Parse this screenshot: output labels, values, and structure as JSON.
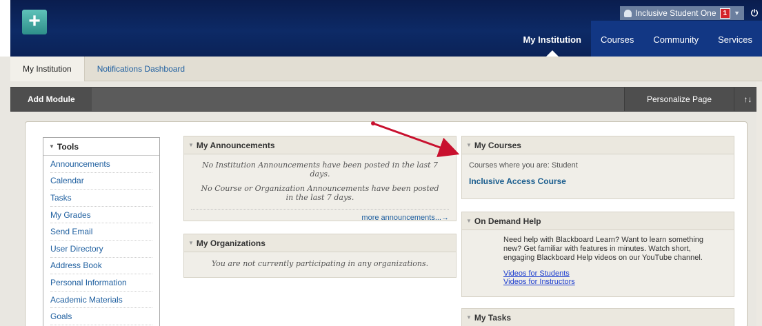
{
  "header": {
    "user_name": "Inclusive Student One",
    "notification_count": "1",
    "nav_tabs": [
      "My Institution",
      "Courses",
      "Community",
      "Services"
    ]
  },
  "subtabs": [
    "My Institution",
    "Notifications Dashboard"
  ],
  "toolbar": {
    "add_module": "Add Module",
    "personalize": "Personalize Page",
    "reorder": "↑↓"
  },
  "tools": {
    "title": "Tools",
    "items": [
      "Announcements",
      "Calendar",
      "Tasks",
      "My Grades",
      "Send Email",
      "User Directory",
      "Address Book",
      "Personal Information",
      "Academic Materials",
      "Goals"
    ]
  },
  "announcements": {
    "title": "My Announcements",
    "msg1": "No Institution Announcements have been posted in the last 7 days.",
    "msg2": "No Course or Organization Announcements have been posted in the last 7 days.",
    "more": "more announcements...→"
  },
  "organizations": {
    "title": "My Organizations",
    "msg": "You are not currently participating in any organizations."
  },
  "courses": {
    "title": "My Courses",
    "role_text": "Courses where you are: Student",
    "course": "Inclusive Access Course"
  },
  "help": {
    "title": "On Demand Help",
    "text": "Need help with Blackboard Learn? Want to learn something new? Get familiar with features in minutes. Watch short, engaging Blackboard Help videos on our YouTube channel.",
    "link_students": "Videos for Students",
    "link_instructors": "Videos for Instructors"
  },
  "tasks": {
    "title": "My Tasks"
  },
  "colors": {
    "banner": "#0d2a66",
    "link": "#2060a0",
    "arrow": "#c8102e"
  }
}
